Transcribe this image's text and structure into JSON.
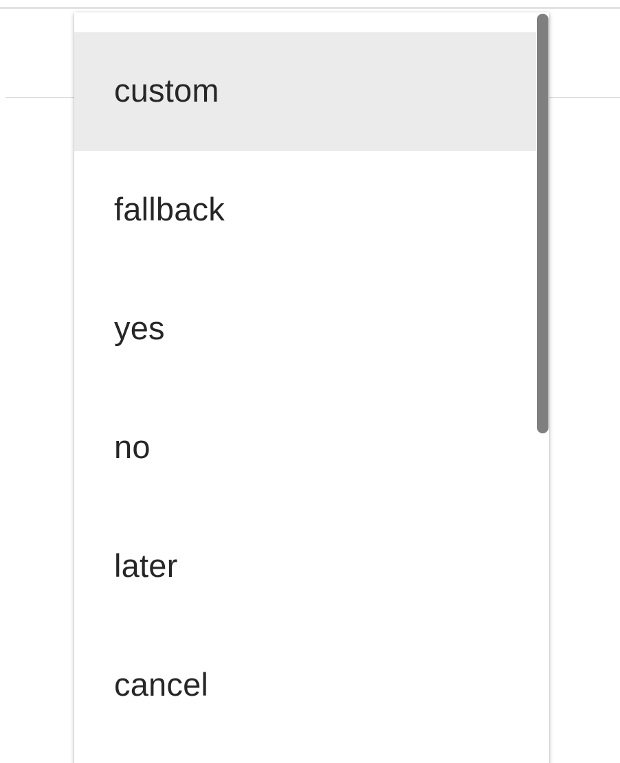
{
  "dropdown": {
    "options": [
      {
        "label": "custom",
        "highlighted": true
      },
      {
        "label": "fallback",
        "highlighted": false
      },
      {
        "label": "yes",
        "highlighted": false
      },
      {
        "label": "no",
        "highlighted": false
      },
      {
        "label": "later",
        "highlighted": false
      },
      {
        "label": "cancel",
        "highlighted": false
      }
    ]
  },
  "colors": {
    "highlight": "#ebebeb",
    "text": "#262626",
    "scrollbar": "#7f7f7f"
  }
}
